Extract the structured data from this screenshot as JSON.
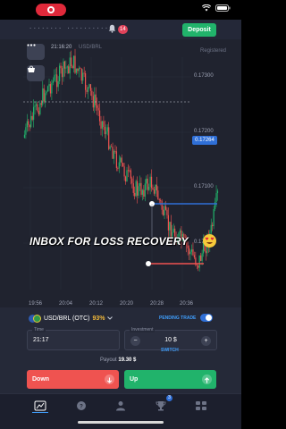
{
  "status_bar": {
    "recording_indicator": "record-icon",
    "icons": [
      "wifi-icon",
      "battery-icon"
    ]
  },
  "header": {
    "balance_masked": "········  ··········",
    "notification_count": "14",
    "deposit_label": "Deposit"
  },
  "chart": {
    "asset_time": "21:16:20",
    "asset_ticker": "USD/BRL",
    "top_right_label": "Registered",
    "current_price": "0.17264",
    "price_axis": [
      "0.17300",
      "0.17200",
      "0.17100",
      "0.17000"
    ],
    "time_axis": [
      "19:56",
      "20:04",
      "20:12",
      "20:20",
      "20:28",
      "20:36"
    ],
    "overlay_caption": "INBOX FOR LOSS RECOVERY",
    "colors": {
      "up": "#21b36b",
      "down": "#ef5350",
      "background": "#20232f",
      "line": "#2f6fd7"
    }
  },
  "trade_panel": {
    "pair": "USD/BRL (OTC)",
    "payout_percent": "93%",
    "pending_trade_label": "PENDING TRADE",
    "time_legend": "Time",
    "time_value": "21:17",
    "investment_legend": "Investment",
    "investment_value": "10 $",
    "minus": "−",
    "plus": "+",
    "switch_label": "SWITCH",
    "payout_label": "Payout",
    "payout_value": "19.30 $",
    "down_label": "Down",
    "up_label": "Up"
  },
  "bottom_nav": {
    "items": [
      "chart-icon",
      "help-icon",
      "user-icon",
      "trophy-icon",
      "menu-icon"
    ],
    "badge": "3"
  }
}
